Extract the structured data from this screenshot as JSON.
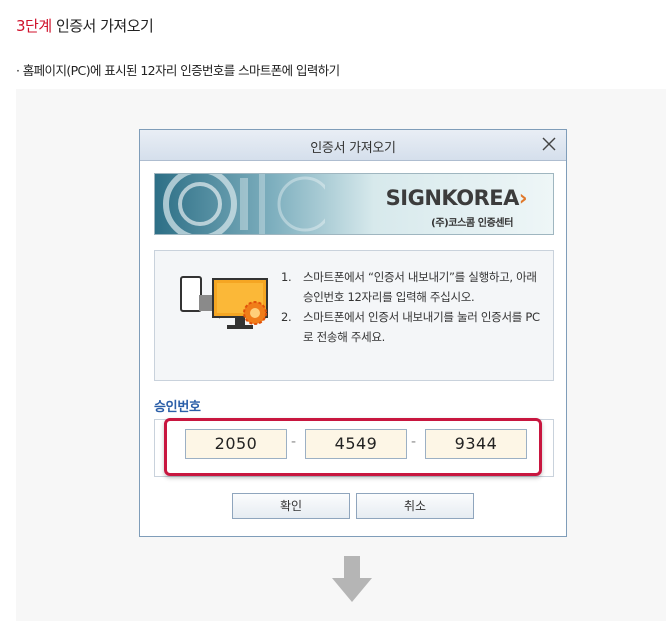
{
  "step": {
    "number": "3단계",
    "title": "인증서 가져오기",
    "description": "· 홈페이지(PC)에 표시된 12자리 인증번호를 스마트폰에 입력하기"
  },
  "dialog": {
    "title": "인증서 가져오기",
    "banner": {
      "logo_main": "SIGNKOREA",
      "logo_arrow": "›",
      "logo_sub": "(주)코스콤 인증센터"
    },
    "instructions": [
      {
        "num": "1.",
        "text": "스마트폰에서 “인증서 내보내기”를 실행하고, 아래 승인번호 12자리를 입력해 주십시오."
      },
      {
        "num": "2.",
        "text": "스마트폰에서 인증서 내보내기를 눌러 인증서를 PC로 전송해 주세요."
      }
    ],
    "auth_label": "승인번호",
    "codes": [
      "2050",
      "4549",
      "9344"
    ],
    "separator": "-",
    "confirm_label": "확인",
    "cancel_label": "취소"
  },
  "colors": {
    "accent_red": "#d0112b",
    "highlight_border": "#c8163f",
    "label_blue": "#2a5ea8",
    "logo_orange": "#e0782a"
  },
  "icons": [
    "close-icon",
    "certificate-transfer-icon",
    "down-arrow-icon"
  ]
}
